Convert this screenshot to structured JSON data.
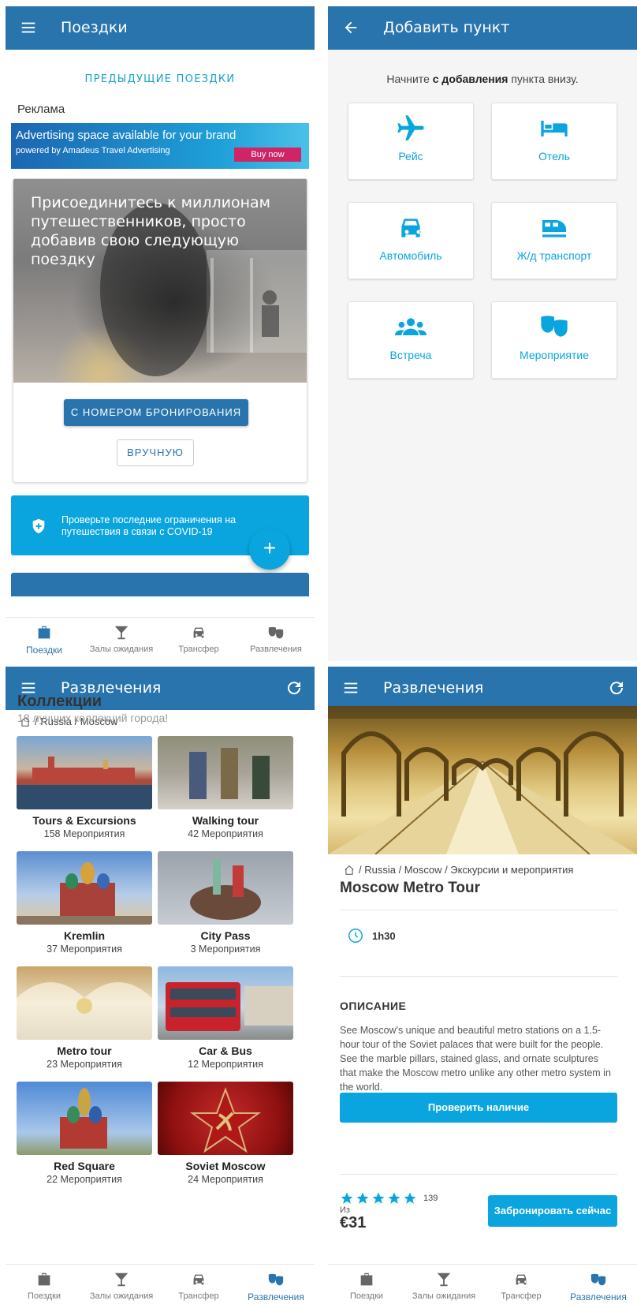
{
  "nav": {
    "trips": "Поездки",
    "lounges": "Залы ожидания",
    "transfer": "Трансфер",
    "entertainment": "Развлечения"
  },
  "screen1": {
    "title": "Поездки",
    "prev_trips": "ПРЕДЫДУЩИЕ ПОЕЗДКИ",
    "ad_label": "Реклама",
    "ad_line1": "Advertising space available for your brand",
    "ad_line2": "powered by Amadeus Travel Advertising",
    "ad_button": "Buy now",
    "hero_text": "Присоединитесь к миллионам путешественников, просто добавив свою следующую поездку",
    "booking_button": "С НОМЕРОМ БРОНИРОВАНИЯ",
    "manual_button": "ВРУЧНУЮ",
    "covid_text": "Проверьте последние ограничения на путешествия в связи с COVID-19",
    "fab": "+"
  },
  "screen2": {
    "title": "Добавить пункт",
    "hint_pre": "Начните ",
    "hint_bold": "с добавления",
    "hint_post": " пункта внизу.",
    "tiles": [
      "Рейс",
      "Отель",
      "Автомобиль",
      "Ж/д транспорт",
      "Встреча",
      "Мероприятие"
    ]
  },
  "screen3": {
    "title": "Развлечения",
    "breadcrumb": "/ Russia / Moscow",
    "heading": "Коллекции",
    "subheading": "18 лучших коллекций города!",
    "collections": [
      {
        "name": "Tours & Excursions",
        "count": "158 Мероприятия"
      },
      {
        "name": "Walking tour",
        "count": "42 Мероприятия"
      },
      {
        "name": "Kremlin",
        "count": "37 Мероприятия"
      },
      {
        "name": "City Pass",
        "count": "3 Мероприятия"
      },
      {
        "name": "Metro tour",
        "count": "23 Мероприятия"
      },
      {
        "name": "Car & Bus",
        "count": "12 Мероприятия"
      },
      {
        "name": "Red Square",
        "count": "22 Мероприятия"
      },
      {
        "name": "Soviet Moscow",
        "count": "24 Мероприятия"
      }
    ]
  },
  "screen4": {
    "title": "Развлечения",
    "breadcrumb": "/ Russia / Moscow / Экскурсии и мероприятия",
    "tour_title": "Moscow Metro Tour",
    "duration": "1h30",
    "desc_heading": "ОПИСАНИЕ",
    "description": "See Moscow's unique and beautiful metro stations on a 1.5-hour tour of the Soviet palaces that were built for the people. See the marble pillars, stained glass, and ornate sculptures that make the Moscow metro unlike any other metro system in the world.",
    "check_button": "Проверить наличие",
    "rating": 5,
    "reviews": "139",
    "from_label": "Из",
    "price": "€31",
    "book_button": "Забронировать сейчас"
  },
  "colors": {
    "primary": "#2a74ad",
    "accent": "#0aa5de",
    "ad_button": "#cf2567"
  }
}
